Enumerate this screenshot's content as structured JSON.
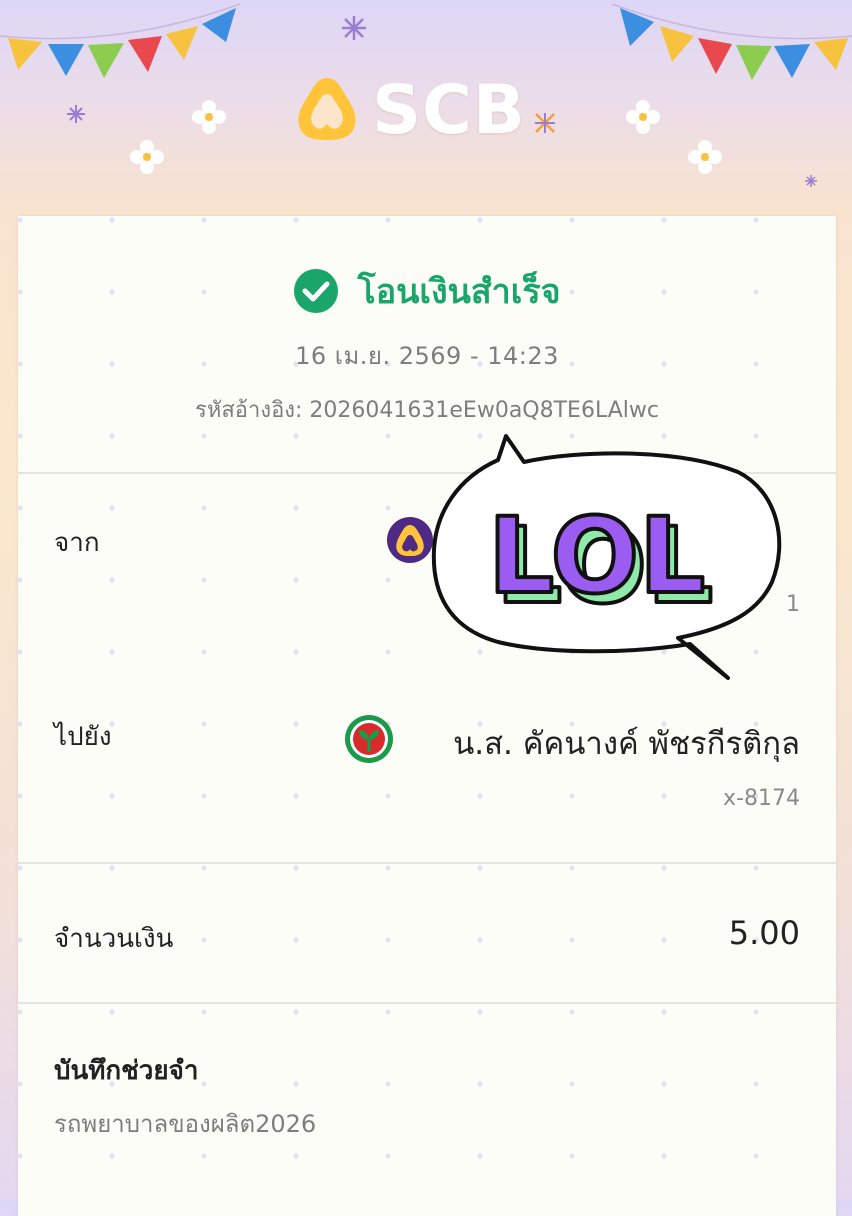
{
  "brand": {
    "name": "SCB",
    "color": "#ffc43a"
  },
  "status": {
    "text": "โอนเงินสำเร็จ",
    "color": "#1aa56a",
    "icon": "check-circle-icon"
  },
  "transaction": {
    "datetime": "16 เม.ย. 2569 - 14:23",
    "reference": "รหัสอ้างอิง: 2026041631eEw0aQ8TE6LAlwc"
  },
  "from": {
    "label": "จาก",
    "bank_icon": "scb-bank-icon",
    "account_suffix": "1"
  },
  "to": {
    "label": "ไปยัง",
    "bank_icon": "kbank-bank-icon",
    "name": "น.ส. คัคนางค์ พัชรกีรติกุล",
    "account": "x-8174"
  },
  "amount": {
    "label": "จำนวนเงิน",
    "value": "5.00"
  },
  "memo": {
    "label": "บันทึกช่วยจำ",
    "value": "รถพยาบาลของผลิต2026"
  },
  "sticker": {
    "text": "LOL",
    "fill": "#9b5cf2",
    "side": "#8fe9a8"
  }
}
